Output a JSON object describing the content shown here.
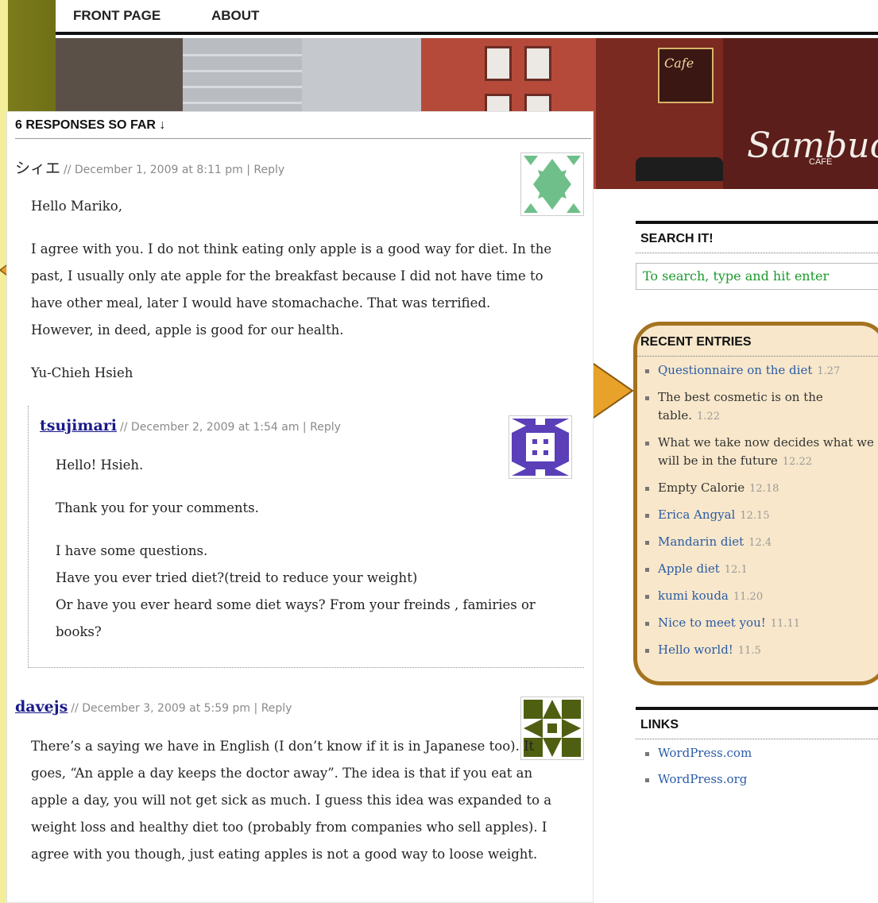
{
  "nav": {
    "front_page": "FRONT PAGE",
    "about": "ABOUT"
  },
  "header_image": {
    "cafe_sign": "Cafe",
    "sign_text": "Sambuca",
    "sign_sub": "CAFE"
  },
  "comments_section": {
    "heading": "6 RESPONSES SO FAR ↓",
    "comments": [
      {
        "author": "シィエ",
        "date": "December 1, 2009 at 8:11 pm",
        "reply_label": "Reply",
        "paragraphs": [
          "Hello Mariko,",
          "I agree with you. I do not think eating only apple is a good way for diet. In the past, I usually only ate apple for the breakfast because I did not have time to have other meal, later I would have stomachache. That was terrified. However, in deed, apple is good for our health.",
          "Yu-Chieh Hsieh"
        ],
        "avatar_color": "#6fbf8a"
      },
      {
        "author": "tsujimari",
        "date": "December 2, 2009 at 1:54 am",
        "reply_label": "Reply",
        "paragraphs": [
          "Hello! Hsieh.",
          "Thank you for your comments.",
          "I have some questions.\nHave you ever tried diet?(treid to reduce your weight)\nOr have you ever heard some diet ways? From your freinds , famiries or books?"
        ],
        "avatar_color": "#5a3fb8"
      },
      {
        "author": "davejs",
        "date": "December 3, 2009 at 5:59 pm",
        "reply_label": "Reply",
        "paragraphs": [
          "There’s a saying we have in English (I don’t know if it is in Japanese too). It goes, “An apple a day keeps the doctor away”. The idea is that if you eat an apple a day, you will not get sick as much. I guess this idea was expanded to a weight loss and healthy diet too (probably from companies who sell apples). I agree with you though, just eating apples is not a good way to loose weight."
        ],
        "avatar_color": "#4f5f12"
      }
    ]
  },
  "sidebar": {
    "search": {
      "title": "SEARCH IT!",
      "placeholder": "To search, type and hit enter"
    },
    "recent": {
      "title": "RECENT ENTRIES",
      "items": [
        {
          "label": "Questionnaire on the diet",
          "date": "1.27",
          "link": true
        },
        {
          "label": "The best cosmetic is on the table.",
          "date": "1.22",
          "link": false
        },
        {
          "label": "What we take now decides what we will be in the future",
          "date": "12.22",
          "link": false
        },
        {
          "label": "Empty Calorie",
          "date": "12.18",
          "link": false
        },
        {
          "label": "Erica Angyal",
          "date": "12.15",
          "link": true
        },
        {
          "label": "Mandarin diet",
          "date": "12.4",
          "link": true
        },
        {
          "label": "Apple diet",
          "date": "12.1",
          "link": true
        },
        {
          "label": "kumi kouda",
          "date": "11.20",
          "link": true
        },
        {
          "label": "Nice to meet you!",
          "date": "11.11",
          "link": true
        },
        {
          "label": "Hello world!",
          "date": "11.5",
          "link": true
        }
      ]
    },
    "links": {
      "title": "LINKS",
      "items": [
        "WordPress.com",
        "WordPress.org"
      ]
    }
  },
  "colors": {
    "backdrop": "#6b6b15",
    "highlight_fill": "#f7e4c4",
    "highlight_border": "#a47320",
    "arrow": "#e8a22a",
    "link": "#2a5ca6",
    "search_text": "#1c9a2c"
  }
}
